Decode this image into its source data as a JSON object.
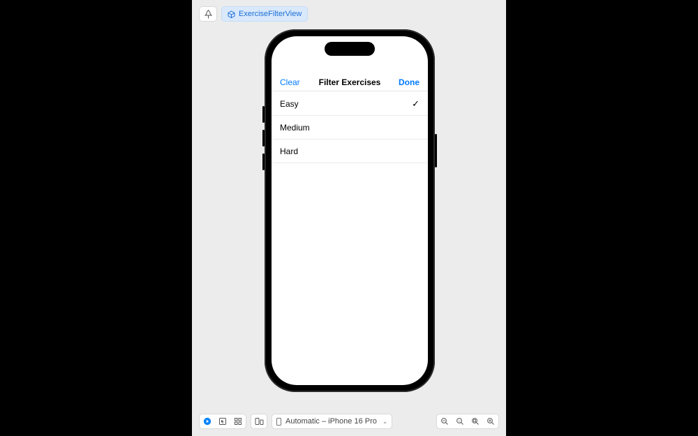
{
  "topbar": {
    "view_name": "ExerciseFilterView"
  },
  "preview": {
    "nav": {
      "clear": "Clear",
      "title": "Filter Exercises",
      "done": "Done"
    },
    "rows": [
      {
        "label": "Easy",
        "selected": true
      },
      {
        "label": "Medium",
        "selected": false
      },
      {
        "label": "Hard",
        "selected": false
      }
    ]
  },
  "bottombar": {
    "device_label": "Automatic – iPhone 16 Pro"
  }
}
